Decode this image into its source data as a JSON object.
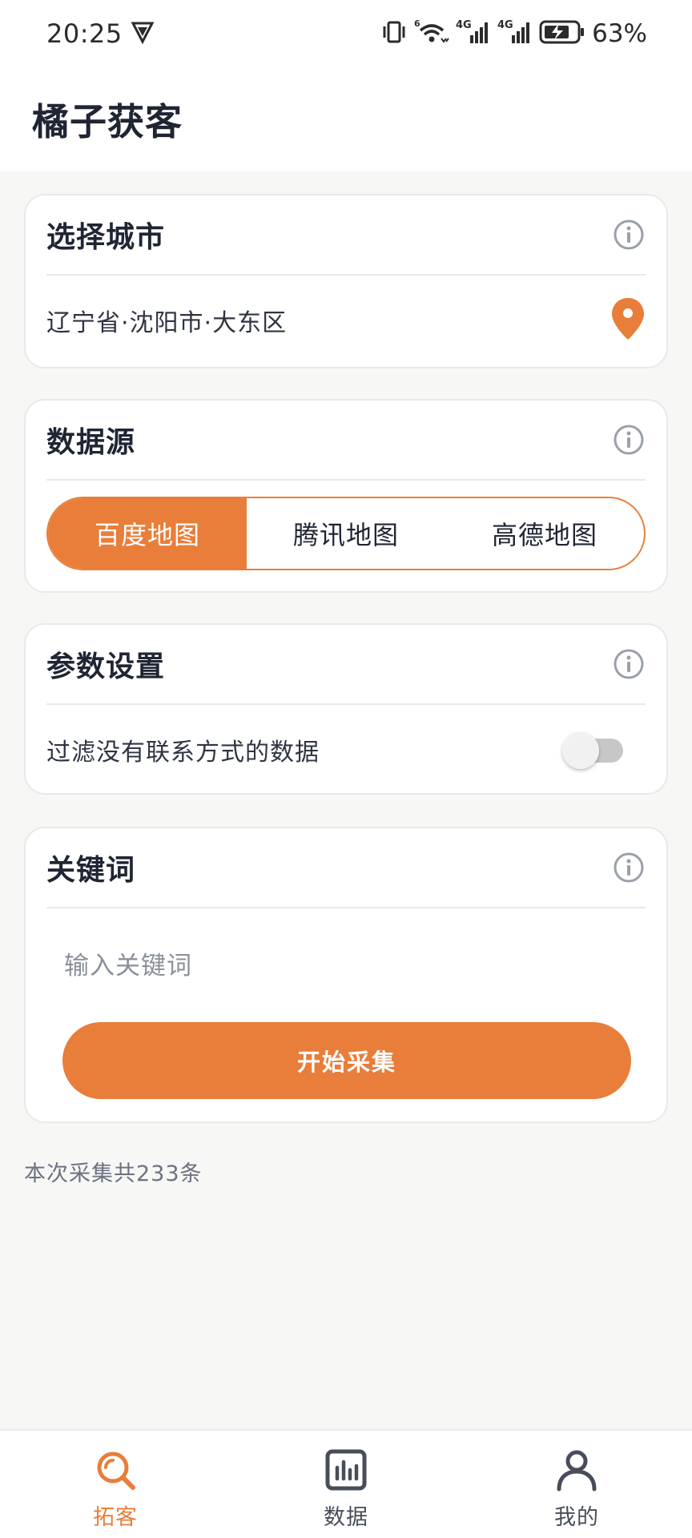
{
  "status_bar": {
    "time": "20:25",
    "battery_percent": "63%",
    "network_labels": [
      "6",
      "4G",
      "4G"
    ]
  },
  "app": {
    "title": "橘子获客"
  },
  "city_card": {
    "title": "选择城市",
    "location": "辽宁省·沈阳市·大东区"
  },
  "source_card": {
    "title": "数据源",
    "options": [
      "百度地图",
      "腾讯地图",
      "高德地图"
    ],
    "selected": "百度地图"
  },
  "param_card": {
    "title": "参数设置",
    "filter_label": "过滤没有联系方式的数据",
    "filter_enabled": false
  },
  "keyword_card": {
    "title": "关键词",
    "input_placeholder": "输入关键词",
    "input_value": "",
    "start_button": "开始采集"
  },
  "result": {
    "text": "本次采集共233条"
  },
  "bottom_nav": {
    "items": [
      {
        "label": "拓客",
        "icon": "search-icon",
        "active": true
      },
      {
        "label": "数据",
        "icon": "chart-icon",
        "active": false
      },
      {
        "label": "我的",
        "icon": "user-icon",
        "active": false
      }
    ]
  },
  "colors": {
    "accent": "#e87e3a",
    "text_primary": "#1f2533",
    "background": "#f7f7f5",
    "info_icon": "#9aa0aa"
  }
}
